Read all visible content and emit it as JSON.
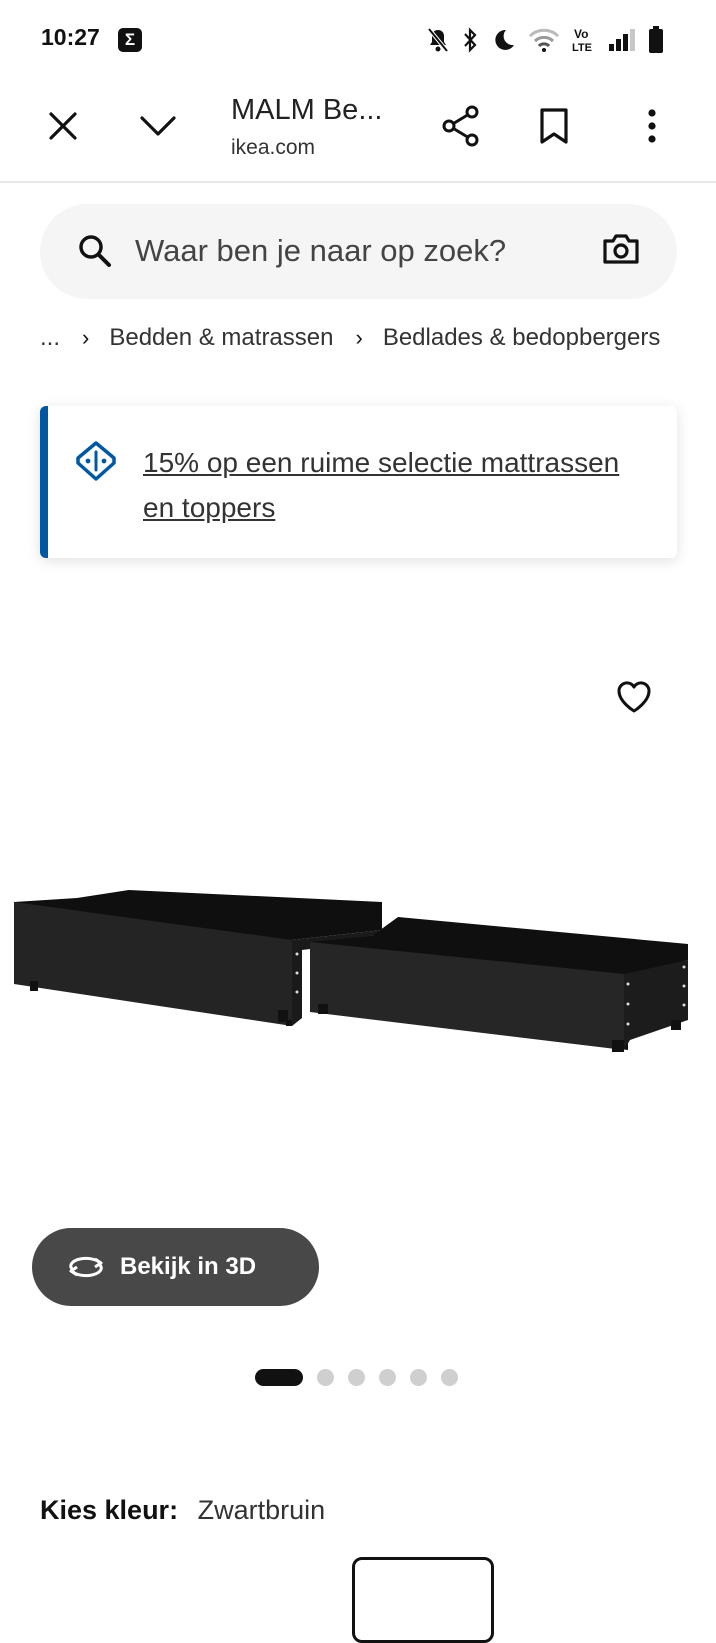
{
  "status_bar": {
    "time": "10:27",
    "app_badge": "Σ",
    "icons": [
      "notifications-off-icon",
      "bluetooth-icon",
      "do-not-disturb-moon-icon",
      "wifi-icon",
      "volte-icon",
      "signal-icon",
      "battery-icon"
    ],
    "volte_text_1": "Vo",
    "volte_text_2": "LTE"
  },
  "tab_bar": {
    "title": "MALM Be...",
    "domain": "ikea.com"
  },
  "search": {
    "placeholder": "Waar ben je naar op zoek?"
  },
  "breadcrumb": {
    "ellipsis": "...",
    "items": [
      "Bedden & matrassen",
      "Bedlades & bedopbergers"
    ]
  },
  "promo": {
    "text": "15% op een ruime selectie mattrassen en toppers",
    "accent": "#0058a3"
  },
  "product": {
    "view_3d_label": "Bekijk in 3D",
    "carousel_count": 6,
    "carousel_active": 1
  },
  "color": {
    "label": "Kies kleur:",
    "value": "Zwartbruin"
  }
}
